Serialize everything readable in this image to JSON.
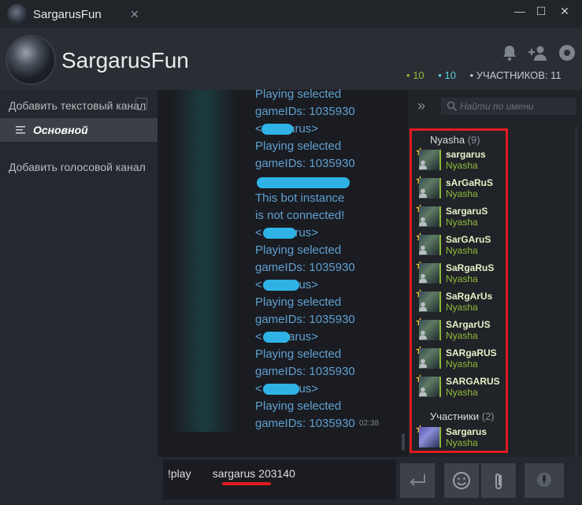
{
  "window": {
    "title": "SargarusFun",
    "close_tab": "✕",
    "minimize": "—",
    "maximize": "☐",
    "close": "✕"
  },
  "header": {
    "group_name": "SargarusFun",
    "stats": {
      "in_game": "10",
      "online": "10",
      "members_label": "УЧАСТНИКОВ: 11"
    }
  },
  "sidebar": {
    "add_text_channel": "Добавить текстовый канал",
    "active_channel": "Основной",
    "add_voice_channel": "Добавить голосовой канал"
  },
  "chat": {
    "lines": [
      {
        "text": "Playing selected"
      },
      {
        "text": "gameIDs: 1035930"
      },
      {
        "text": "<        sargarus>"
      },
      {
        "text": "Playing selected"
      },
      {
        "text": "gameIDs: 1035930"
      },
      {
        "text": ""
      },
      {
        "text": "This bot instance"
      },
      {
        "text": "is not connected!"
      },
      {
        "text": "<         sargarus>"
      },
      {
        "text": "Playing selected"
      },
      {
        "text": "gameIDs: 1035930"
      },
      {
        "text": "<          sargarus>"
      },
      {
        "text": "Playing selected"
      },
      {
        "text": "gameIDs: 1035930"
      },
      {
        "text": "<       sargarus>"
      },
      {
        "text": "Playing selected"
      },
      {
        "text": "gameIDs: 1035930"
      },
      {
        "text": "<           sargarus>"
      },
      {
        "text": "Playing selected"
      },
      {
        "text": "gameIDs: 1035930"
      }
    ],
    "timestamp": "02:38"
  },
  "members": {
    "search_placeholder": "Найти по имени",
    "groups": [
      {
        "title": "Nyasha",
        "count": "(9)",
        "members": [
          {
            "name": "sargarus",
            "game": "Nyasha"
          },
          {
            "name": "sArGaRuS",
            "game": "Nyasha"
          },
          {
            "name": "SargaruS",
            "game": "Nyasha"
          },
          {
            "name": "SarGAruS",
            "game": "Nyasha"
          },
          {
            "name": "SaRgaRuS",
            "game": "Nyasha"
          },
          {
            "name": "SaRgArUs",
            "game": "Nyasha"
          },
          {
            "name": "SArgarUS",
            "game": "Nyasha"
          },
          {
            "name": "SARgaRUS",
            "game": "Nyasha"
          },
          {
            "name": "SARGARUS",
            "game": "Nyasha"
          }
        ]
      },
      {
        "title": "Участники",
        "count": "(2)",
        "members": [
          {
            "name": "Sargarus",
            "game": "Nyasha"
          }
        ]
      }
    ]
  },
  "composer": {
    "text": "!play       sargarus 203140"
  },
  "colors": {
    "highlight": "#e11b22",
    "in_game": "#90ba3c",
    "online": "#57cbde",
    "chat_text": "#5fa0d0"
  }
}
